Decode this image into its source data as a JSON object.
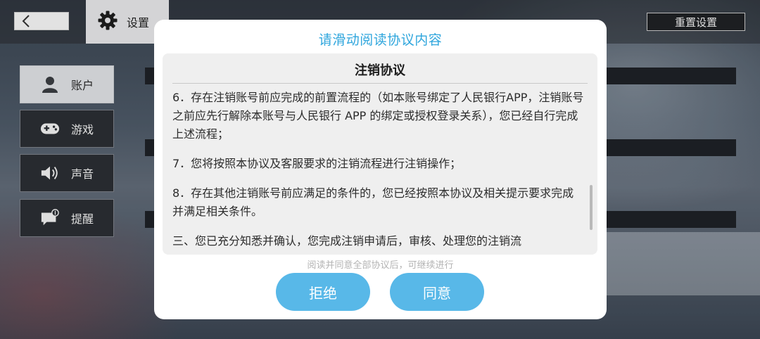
{
  "header": {
    "back_icon": "chevron-left-icon",
    "settings_icon": "gear-icon",
    "settings_label": "设置",
    "reset_label": "重置设置"
  },
  "sidebar": {
    "items": [
      {
        "label": "账户",
        "icon": "user-icon",
        "active": true
      },
      {
        "label": "游戏",
        "icon": "gamepad-icon",
        "active": false
      },
      {
        "label": "声音",
        "icon": "speaker-icon",
        "active": false
      },
      {
        "label": "提醒",
        "icon": "message-alert-icon",
        "active": false
      }
    ]
  },
  "modal": {
    "title": "请滑动阅读协议内容",
    "doc_title": "注销协议",
    "paragraphs": [
      "6．存在注销账号前应完成的前置流程的（如本账号绑定了人民银行APP，注销账号之前应先行解除本账号与人民银行 APP 的绑定或授权登录关系），您已经自行完成上述流程；",
      "7．您将按照本协议及客服要求的注销流程进行注销操作；",
      "8．存在其他注销账号前应满足的条件的，您已经按照本协议及相关提示要求完成并满足相关条件。",
      "三、您已充分知悉并确认，您完成注销申请后，审核、处理您的注销流"
    ],
    "hint": "阅读并同意全部协议后，可继续进行",
    "reject_label": "拒绝",
    "agree_label": "同意"
  },
  "colors": {
    "accent": "#2fa6dd",
    "button": "#58b8e8"
  }
}
